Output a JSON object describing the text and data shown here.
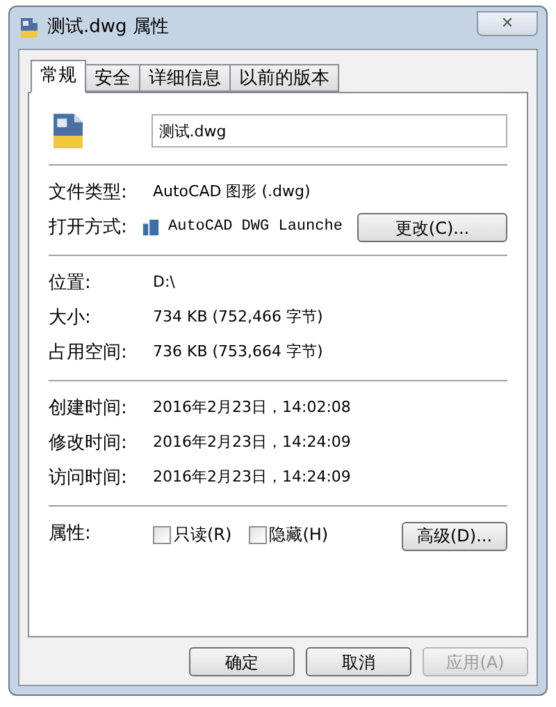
{
  "window": {
    "title": "测试.dwg 属性",
    "close": "✕"
  },
  "tabs": [
    {
      "label": "常规",
      "selected": true
    },
    {
      "label": "安全",
      "selected": false
    },
    {
      "label": "详细信息",
      "selected": false
    },
    {
      "label": "以前的版本",
      "selected": false
    }
  ],
  "file_name": "测试.dwg",
  "groups": [
    [
      {
        "label": "文件类型:",
        "value": "AutoCAD 图形 (.dwg)"
      },
      {
        "label": "打开方式:",
        "value": "AutoCAD DWG Launche",
        "kind": "app",
        "button": "更改(C)..."
      }
    ],
    [
      {
        "label": "位置:",
        "value": "D:\\"
      },
      {
        "label": "大小:",
        "value": "734 KB (752,466 字节)"
      },
      {
        "label": "占用空间:",
        "value": "736 KB (753,664 字节)"
      }
    ],
    [
      {
        "label": "创建时间:",
        "value": "2016年2月23日，14:02:08"
      },
      {
        "label": "修改时间:",
        "value": "2016年2月23日，14:24:09"
      },
      {
        "label": "访问时间:",
        "value": "2016年2月23日，14:24:09"
      }
    ]
  ],
  "attributes": {
    "label": "属性:",
    "options": [
      {
        "label": "只读(R)",
        "checked": false
      },
      {
        "label": "隐藏(H)",
        "checked": false
      }
    ],
    "button": "高级(D)..."
  },
  "buttons": [
    {
      "label": "确定",
      "disabled": false
    },
    {
      "label": "取消",
      "disabled": false
    },
    {
      "label": "应用(A)",
      "disabled": true
    }
  ]
}
